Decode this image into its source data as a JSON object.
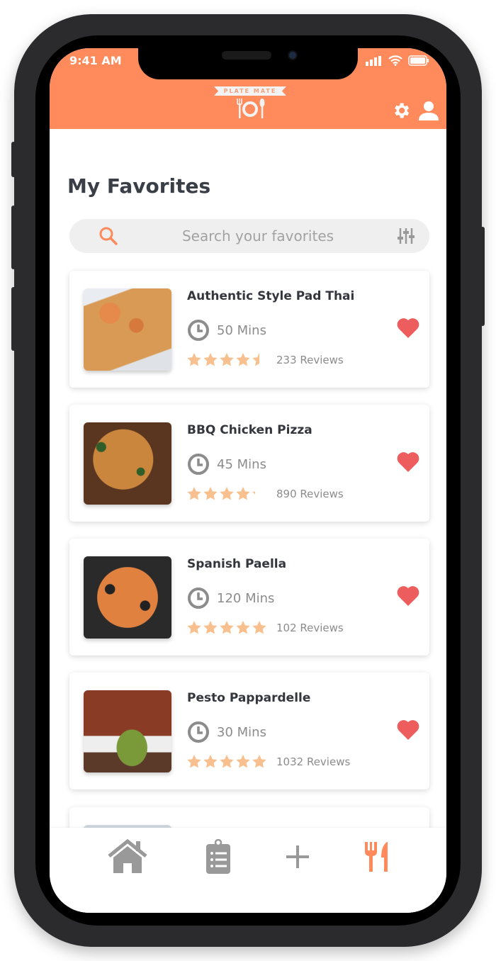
{
  "status_bar": {
    "time": "9:41 AM"
  },
  "header": {
    "logo_text": "PLATE MATE",
    "settings_icon": "gear-icon",
    "profile_icon": "user-icon"
  },
  "page": {
    "title": "My Favorites"
  },
  "search": {
    "placeholder": "Search your favorites",
    "value": "",
    "filter_icon": "sliders-icon"
  },
  "colors": {
    "accent": "#ff8a5b",
    "heart": "#ee5d5d",
    "star": "#f7c08e",
    "text": "#33373d",
    "muted": "#8c8c8c"
  },
  "favorites": [
    {
      "name": "Authentic Style Pad Thai",
      "time": "50 Mins",
      "rating": 4.5,
      "reviews": "233 Reviews",
      "favorited": true
    },
    {
      "name": "BBQ Chicken Pizza",
      "time": "45 Mins",
      "rating": 4.2,
      "reviews": "890 Reviews",
      "favorited": true
    },
    {
      "name": "Spanish Paella",
      "time": "120 Mins",
      "rating": 5,
      "reviews": "102 Reviews",
      "favorited": true
    },
    {
      "name": "Pesto  Pappardelle",
      "time": "30 Mins",
      "rating": 5,
      "reviews": "1032 Reviews",
      "favorited": true
    }
  ],
  "nav": {
    "items": [
      {
        "icon": "home-icon"
      },
      {
        "icon": "clipboard-list-icon"
      },
      {
        "icon": "plus-icon"
      },
      {
        "icon": "fork-knife-icon",
        "active": true
      }
    ]
  }
}
